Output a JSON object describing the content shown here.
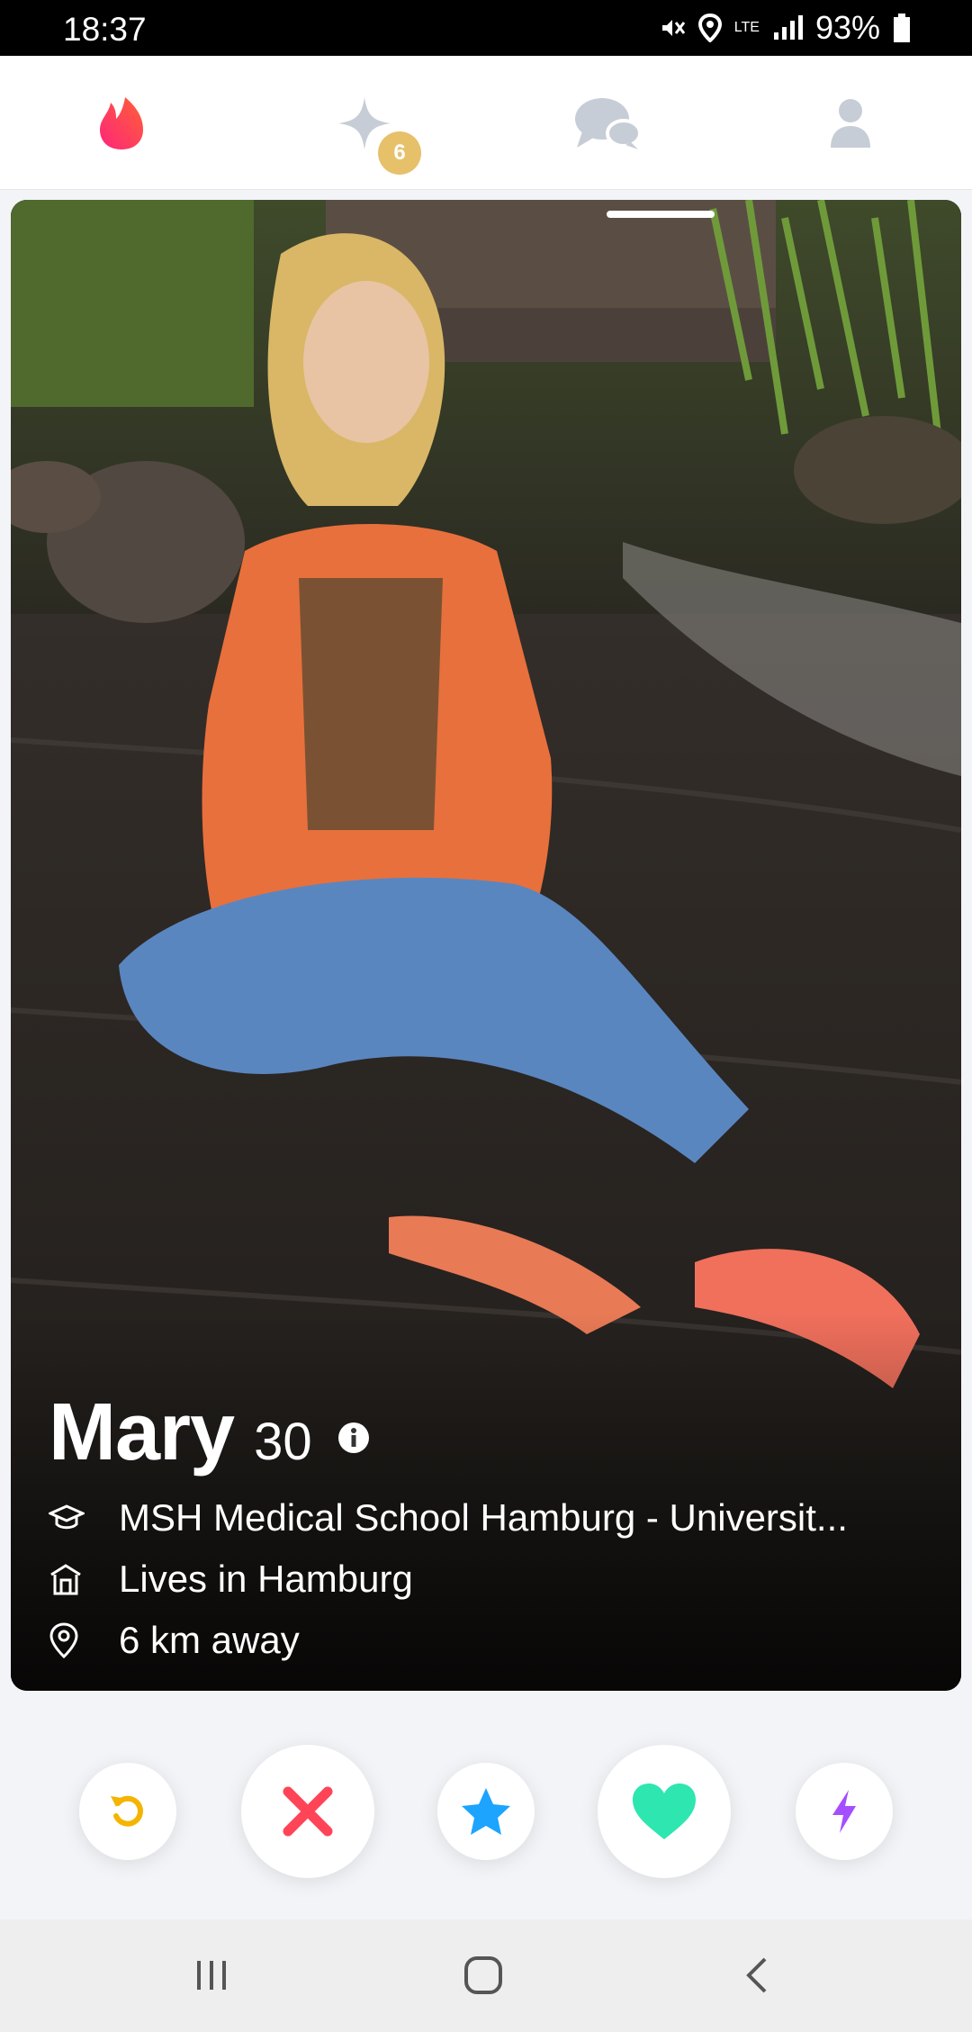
{
  "status_bar": {
    "time": "18:37",
    "network": "LTE",
    "battery": "93%",
    "icons": [
      "mute-icon",
      "location-icon",
      "lte-icon",
      "signal-icon",
      "battery-icon"
    ]
  },
  "top_nav": {
    "tabs": [
      {
        "name": "discover",
        "icon": "flame-icon",
        "active": true
      },
      {
        "name": "top-picks",
        "icon": "sparkle-icon",
        "badge": "6"
      },
      {
        "name": "messages",
        "icon": "chat-bubbles-icon"
      },
      {
        "name": "profile",
        "icon": "person-icon"
      }
    ]
  },
  "profile_card": {
    "name": "Mary",
    "age": "30",
    "school": "MSH Medical School Hamburg - Universit...",
    "lives_in": "Lives in Hamburg",
    "distance": "6 km away",
    "photo_index": 1
  },
  "actions": [
    {
      "name": "rewind",
      "icon": "rewind-icon",
      "color": "#f5b400"
    },
    {
      "name": "nope",
      "icon": "x-icon",
      "color": "#ff4458"
    },
    {
      "name": "super-like",
      "icon": "star-icon",
      "color": "#1ca4ff"
    },
    {
      "name": "like",
      "icon": "heart-icon",
      "color": "#2ee6b0"
    },
    {
      "name": "boost",
      "icon": "bolt-icon",
      "color": "#a54eff"
    }
  ],
  "colors": {
    "brand": "#fd5068",
    "inactive_icon": "#c7cdd6",
    "badge": "#e7c06a"
  }
}
